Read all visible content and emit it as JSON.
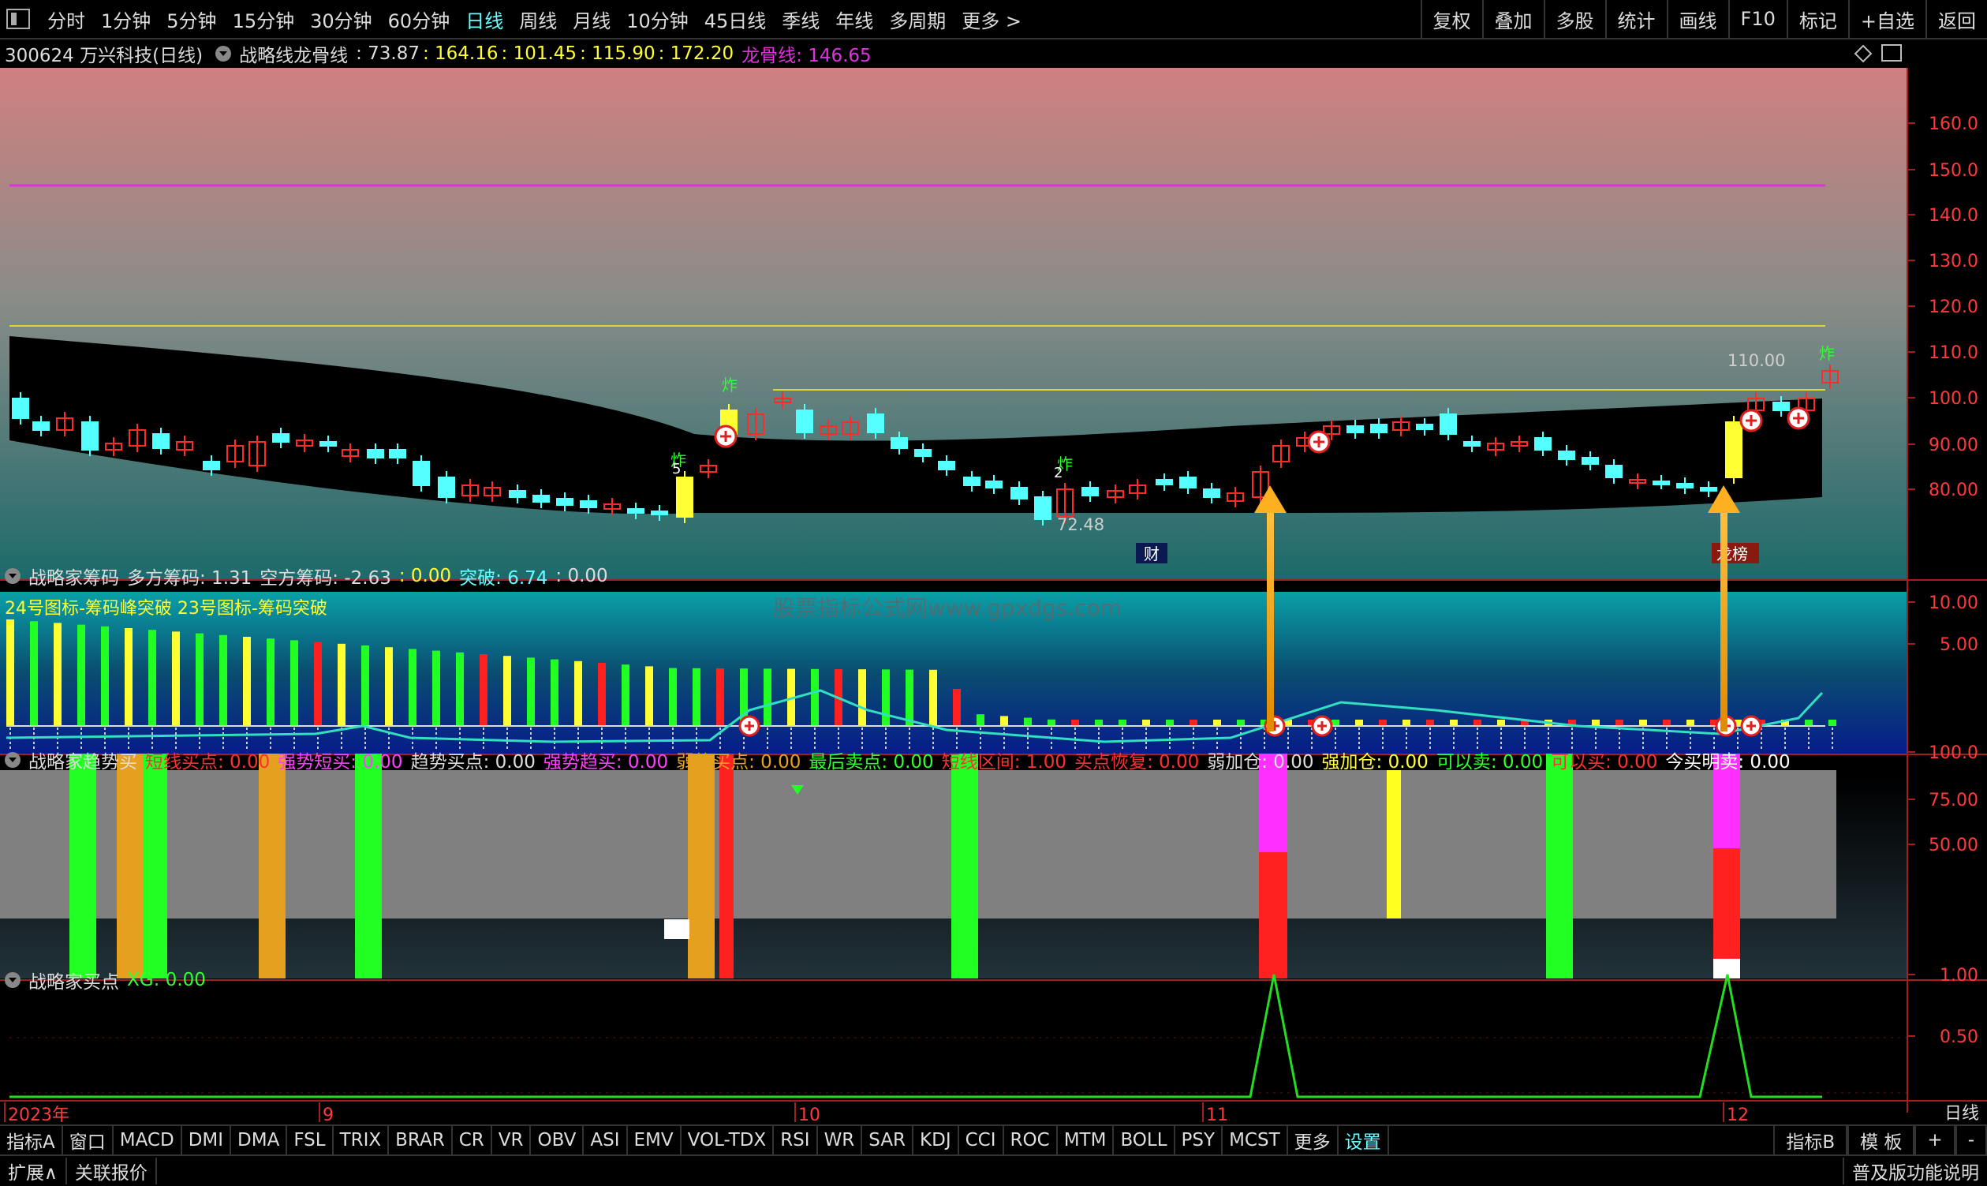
{
  "toolbar": {
    "timeframes": [
      "分时",
      "1分钟",
      "5分钟",
      "15分钟",
      "30分钟",
      "60分钟",
      "日线",
      "周线",
      "月线",
      "10分钟",
      "45日线",
      "季线",
      "年线",
      "多周期",
      "更多 >"
    ],
    "active_timeframe": "日线",
    "right_buttons": [
      "复权",
      "叠加",
      "多股",
      "统计",
      "画线",
      "F10",
      "标记",
      "+自选",
      "返回"
    ]
  },
  "main_header": {
    "stock": "300624 万兴科技(日线)",
    "indicator": "战略线龙骨线",
    "v1": ": 73.87",
    "v2": ": 164.16",
    "v3": ": 101.45",
    "v4": ": 115.90",
    "v5": ": 172.20",
    "dragon_label": "龙骨线: 146.65"
  },
  "main_axis": [
    "160.0",
    "150.0",
    "140.0",
    "130.0",
    "120.0",
    "110.0",
    "100.0",
    "90.00",
    "80.00"
  ],
  "main_annotations": {
    "high_label": "110.00",
    "low_label": "72.48",
    "cai": "财",
    "longhu": "龙榜",
    "zha": "炸",
    "tag5": "5",
    "tag2": "2"
  },
  "chip_header": {
    "title": "战略家筹码",
    "long_label": "多方筹码: 1.31",
    "short_label": "空方筹码: -2.63",
    "v1": ": 0.00",
    "break_label": "突破: 6.74",
    "v2": ": 0.00",
    "legend": "24号图标-筹码峰突破 23号图标-筹码突破"
  },
  "chip_axis": [
    "10.00",
    "5.00"
  ],
  "watermark": "股票指标公式网www.gpxdgs.com",
  "trend_header": {
    "title": "战略家趋势买",
    "items": [
      {
        "t": "短线买点: 0.00",
        "c": "#ff3030"
      },
      {
        "t": "强势短买: 0.00",
        "c": "#ff40ff"
      },
      {
        "t": "趋势买点: 0.00",
        "c": "#dddddd"
      },
      {
        "t": "强势趋买: 0.00",
        "c": "#ff40ff"
      },
      {
        "t": "弱势买点: 0.00",
        "c": "#e6a020"
      },
      {
        "t": "最后卖点: 0.00",
        "c": "#30ff30"
      },
      {
        "t": "短线区间: 1.00",
        "c": "#ff3030"
      },
      {
        "t": "买点恢复: 0.00",
        "c": "#ff3030"
      },
      {
        "t": "弱加仓: 0.00",
        "c": "#dddddd"
      },
      {
        "t": "强加仓: 0.00",
        "c": "#ffff40"
      },
      {
        "t": "可以卖: 0.00",
        "c": "#30ff30"
      },
      {
        "t": "可以买: 0.00",
        "c": "#ff3030"
      },
      {
        "t": "今买明卖: 0.00",
        "c": "#ffffff"
      }
    ]
  },
  "trend_axis": [
    "100.0",
    "75.00",
    "50.00"
  ],
  "buy_header": {
    "title": "战略家买点",
    "xg": "XG: 0.00"
  },
  "buy_axis": [
    "1.00",
    "0.50"
  ],
  "date_axis": {
    "y2023": "2023年",
    "m9": "9",
    "m10": "10",
    "m11": "11",
    "m12": "12",
    "period": "日线"
  },
  "bottom_tabs": [
    "指标A",
    "窗口",
    "MACD",
    "DMI",
    "DMA",
    "FSL",
    "TRIX",
    "BRAR",
    "CR",
    "VR",
    "OBV",
    "ASI",
    "EMV",
    "VOL-TDX",
    "RSI",
    "WR",
    "SAR",
    "KDJ",
    "CCI",
    "ROC",
    "MTM",
    "BOLL",
    "PSY",
    "MCST",
    "更多",
    "设置"
  ],
  "bottom_right_tabs": [
    "指标B",
    "模 板",
    "+",
    "-"
  ],
  "status": {
    "expand": "扩展∧",
    "quote": "关联报价",
    "help": "普及版功能说明"
  },
  "colors": {
    "up": "#ff2a2a",
    "down": "#54ffff",
    "yellow": "#ffff33",
    "magenta": "#e030e0",
    "green": "#22ff22",
    "orange": "#f0a010",
    "gray": "#808080"
  }
}
